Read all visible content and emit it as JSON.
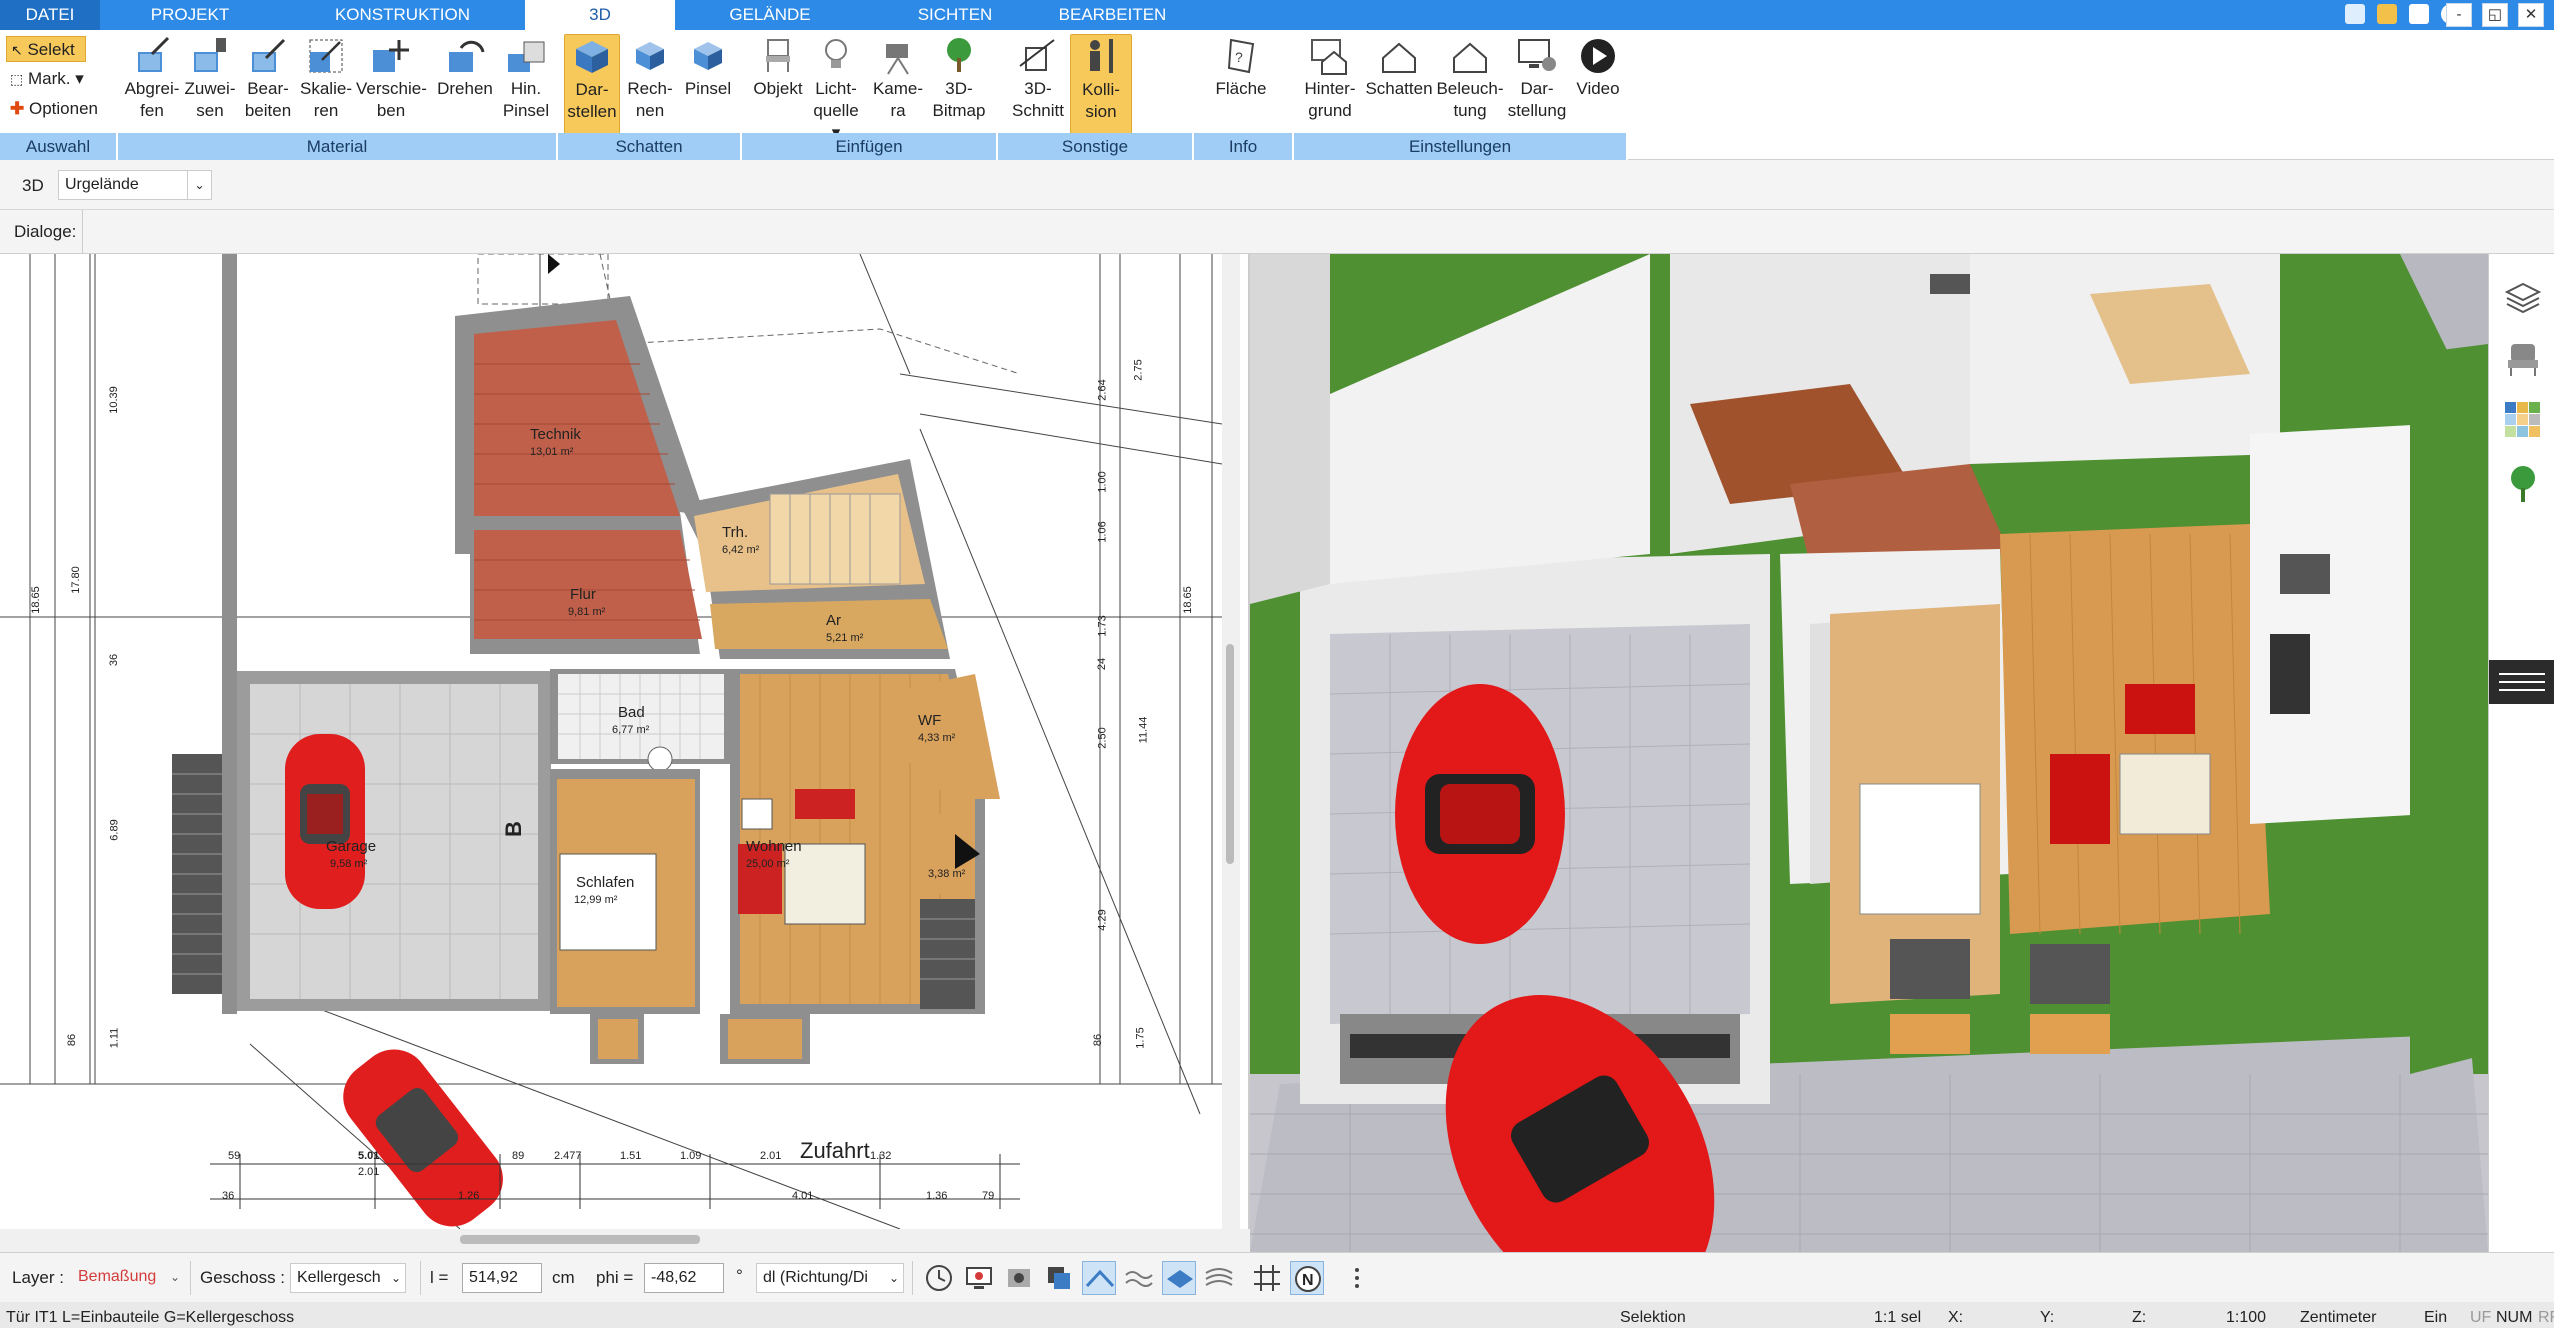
{
  "tabs": [
    {
      "label": "DATEI",
      "active": false
    },
    {
      "label": "PROJEKT",
      "active": false
    },
    {
      "label": "KONSTRUKTION",
      "active": false
    },
    {
      "label": "3D",
      "active": true
    },
    {
      "label": "GELÄNDE",
      "active": false
    },
    {
      "label": "SICHTEN",
      "active": false
    },
    {
      "label": "BEARBEITEN",
      "active": false
    }
  ],
  "window_buttons": [
    "-",
    "◱",
    "✕"
  ],
  "ribbon": {
    "auswahl": {
      "label": "Auswahl",
      "items": [
        "Selekt",
        "Mark.",
        "Optionen"
      ]
    },
    "material": {
      "label": "Material",
      "buttons": [
        {
          "l1": "Abgrei-",
          "l2": "fen"
        },
        {
          "l1": "Zuwei-",
          "l2": "sen"
        },
        {
          "l1": "Bear-",
          "l2": "beiten"
        },
        {
          "l1": "Skalie-",
          "l2": "ren"
        },
        {
          "l1": "Verschie-",
          "l2": "ben"
        },
        {
          "l1": "Drehen",
          "l2": ""
        },
        {
          "l1": "Hin.",
          "l2": "Pinsel"
        }
      ]
    },
    "schatten": {
      "label": "Schatten",
      "buttons": [
        {
          "l1": "Dar-",
          "l2": "stellen"
        },
        {
          "l1": "Rech-",
          "l2": "nen"
        },
        {
          "l1": "Pinsel",
          "l2": ""
        }
      ]
    },
    "einfuegen": {
      "label": "Einfügen",
      "buttons": [
        {
          "l1": "Objekt",
          "l2": ""
        },
        {
          "l1": "Licht-",
          "l2": "quelle"
        },
        {
          "l1": "Kame-",
          "l2": "ra"
        },
        {
          "l1": "3D-",
          "l2": "Bitmap"
        }
      ]
    },
    "sonstige": {
      "label": "Sonstige",
      "buttons": [
        {
          "l1": "3D-",
          "l2": "Schnitt"
        },
        {
          "l1": "Kolli-",
          "l2": "sion"
        }
      ]
    },
    "info": {
      "label": "Info",
      "buttons": [
        {
          "l1": "Fläche",
          "l2": ""
        }
      ]
    },
    "einstellungen": {
      "label": "Einstellungen",
      "buttons": [
        {
          "l1": "Hinter-",
          "l2": "grund"
        },
        {
          "l1": "Schatten",
          "l2": ""
        },
        {
          "l1": "Beleuch-",
          "l2": "tung"
        },
        {
          "l1": "Dar-",
          "l2": "stellung"
        },
        {
          "l1": "Video",
          "l2": ""
        }
      ]
    }
  },
  "toolbar2": {
    "mode": "3D",
    "layer_value": "Urgelände"
  },
  "dialoge_label": "Dialoge:",
  "plan": {
    "rooms": [
      {
        "name": "Technik",
        "area": "13,01 m²"
      },
      {
        "name": "Trh.",
        "area": "6,42 m²"
      },
      {
        "name": "Flur",
        "area": "9,81 m²"
      },
      {
        "name": "Ar",
        "area": "5,21 m²"
      },
      {
        "name": "Bad",
        "area": "6,77 m²"
      },
      {
        "name": "WF",
        "area": "4,33 m²"
      },
      {
        "name": "Garage",
        "area": "9,58 m²"
      },
      {
        "name": "Wohnen",
        "area": "25,00 m²"
      },
      {
        "name": "Schlafen",
        "area": "12,99 m²"
      },
      {
        "name": "",
        "area": "3,38 m²"
      }
    ],
    "street_label": "Zufahrt",
    "section_label": "B",
    "dims_left": [
      "10.39",
      "17.80",
      "18.65",
      "6.89",
      "1.11",
      "36",
      "86"
    ],
    "dims_right": [
      "2.64",
      "2.75",
      "1.00",
      "1.06",
      "18.65",
      "11.44",
      "2.50",
      "4.29",
      "1.73",
      "86",
      "1.75",
      "24"
    ],
    "dims_bottom": [
      "59",
      "5.01",
      "2.01",
      "89",
      "2.477",
      "1.51",
      "1.09",
      "2.01",
      "1.32",
      "36",
      "4.01",
      "1.36",
      "79",
      "1.26"
    ]
  },
  "bottom": {
    "layer_label": "Layer :",
    "layer_value": "Bemaßung",
    "geschoss_label": "Geschoss :",
    "geschoss_value": "Kellergesch",
    "l_label": "l =",
    "l_value": "514,92",
    "l_unit": "cm",
    "phi_label": "phi =",
    "phi_value": "-48,62",
    "phi_unit": "°",
    "dl_value": "dl (Richtung/Di"
  },
  "status": {
    "left": "Tür IT1 L=Einbauteile G=Kellergeschoss",
    "selektion": "Selektion",
    "sel": "1:1 sel",
    "x": "X:",
    "y": "Y:",
    "z": "Z:",
    "scale": "1:100",
    "unit": "Zentimeter",
    "ein": "Ein",
    "uf": "UF",
    "num": "NUM",
    "rf": "RF"
  },
  "colors": {
    "tabbar": "#2d8ae6",
    "group_label": "#9fcdf5",
    "selected": "#f7c95a",
    "dim_red": "#d43b3b"
  }
}
